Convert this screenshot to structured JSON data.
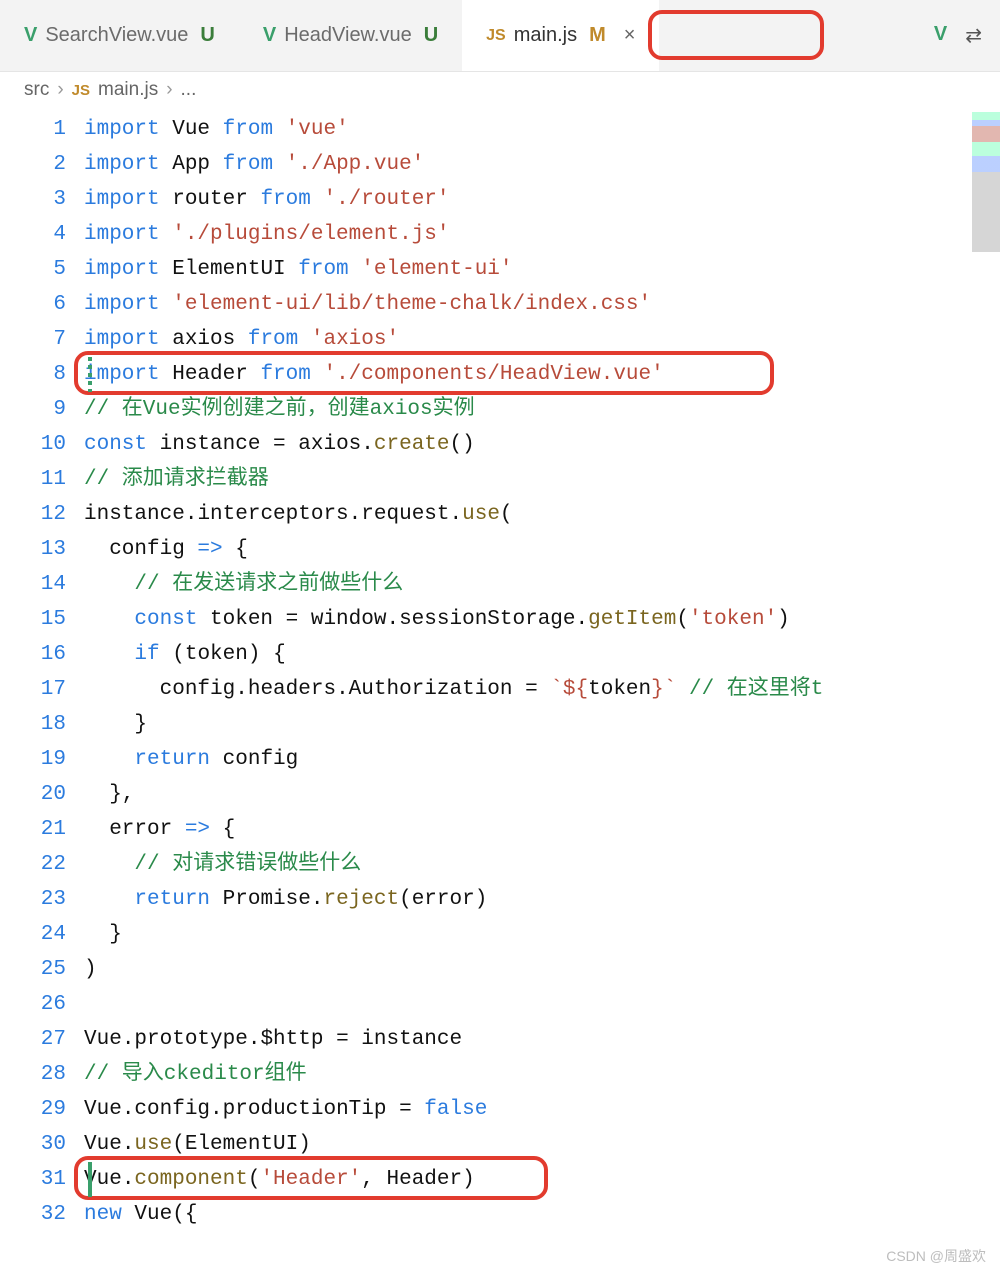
{
  "tabs": [
    {
      "icon": "vue",
      "label": "SearchView.vue",
      "status": "U"
    },
    {
      "icon": "vue",
      "label": "HeadView.vue",
      "status": "U"
    },
    {
      "icon": "js",
      "label": "main.js",
      "status": "M",
      "active": true,
      "closable": true
    },
    {
      "icon": "vue",
      "label": "",
      "status": ""
    }
  ],
  "breadcrumb": {
    "p1": "src",
    "sep": "›",
    "icon": "JS",
    "p2": "main.js",
    "p3": "..."
  },
  "code": {
    "lines": [
      {
        "n": 1,
        "t": [
          [
            "kw",
            "import"
          ],
          [
            "id",
            " Vue "
          ],
          [
            "kw",
            "from"
          ],
          [
            "str",
            " 'vue'"
          ]
        ]
      },
      {
        "n": 2,
        "t": [
          [
            "kw",
            "import"
          ],
          [
            "id",
            " App "
          ],
          [
            "kw",
            "from"
          ],
          [
            "str",
            " './App.vue'"
          ]
        ]
      },
      {
        "n": 3,
        "t": [
          [
            "kw",
            "import"
          ],
          [
            "id",
            " router "
          ],
          [
            "kw",
            "from"
          ],
          [
            "str",
            " './router'"
          ]
        ]
      },
      {
        "n": 4,
        "t": [
          [
            "kw",
            "import"
          ],
          [
            "str",
            " './plugins/element.js'"
          ]
        ]
      },
      {
        "n": 5,
        "t": [
          [
            "kw",
            "import"
          ],
          [
            "id",
            " ElementUI "
          ],
          [
            "kw",
            "from"
          ],
          [
            "str",
            " 'element-ui'"
          ]
        ]
      },
      {
        "n": 6,
        "t": [
          [
            "kw",
            "import"
          ],
          [
            "str",
            " 'element-ui/lib/theme-chalk/index.css'"
          ]
        ]
      },
      {
        "n": 7,
        "t": [
          [
            "kw",
            "import"
          ],
          [
            "id",
            " axios "
          ],
          [
            "kw",
            "from"
          ],
          [
            "str",
            " 'axios'"
          ]
        ]
      },
      {
        "n": 8,
        "t": [
          [
            "kw",
            "import"
          ],
          [
            "id",
            " Header "
          ],
          [
            "kw",
            "from"
          ],
          [
            "str",
            " './components/HeadView.vue'"
          ]
        ],
        "hl": "line8"
      },
      {
        "n": 9,
        "t": [
          [
            "cmt",
            "// 在Vue实例创建之前，创建axios实例"
          ]
        ]
      },
      {
        "n": 10,
        "t": [
          [
            "kw",
            "const"
          ],
          [
            "id",
            " instance "
          ],
          [
            "pun",
            "="
          ],
          [
            "id",
            " axios"
          ],
          [
            "pun",
            "."
          ],
          [
            "func",
            "create"
          ],
          [
            "pun",
            "()"
          ]
        ]
      },
      {
        "n": 11,
        "t": [
          [
            "cmt",
            "// 添加请求拦截器"
          ]
        ]
      },
      {
        "n": 12,
        "t": [
          [
            "id",
            "instance"
          ],
          [
            "pun",
            "."
          ],
          [
            "id",
            "interceptors"
          ],
          [
            "pun",
            "."
          ],
          [
            "id",
            "request"
          ],
          [
            "pun",
            "."
          ],
          [
            "func",
            "use"
          ],
          [
            "pun",
            "("
          ]
        ]
      },
      {
        "n": 13,
        "t": [
          [
            "id",
            "  config "
          ],
          [
            "arrow",
            "=>"
          ],
          [
            "pun",
            " {"
          ]
        ]
      },
      {
        "n": 14,
        "t": [
          [
            "cmt",
            "    // 在发送请求之前做些什么"
          ]
        ]
      },
      {
        "n": 15,
        "t": [
          [
            "kw",
            "    const"
          ],
          [
            "id",
            " token "
          ],
          [
            "pun",
            "="
          ],
          [
            "id",
            " window"
          ],
          [
            "pun",
            "."
          ],
          [
            "id",
            "sessionStorage"
          ],
          [
            "pun",
            "."
          ],
          [
            "func",
            "getItem"
          ],
          [
            "pun",
            "("
          ],
          [
            "str",
            "'token'"
          ],
          [
            "pun",
            ")"
          ]
        ]
      },
      {
        "n": 16,
        "t": [
          [
            "kw",
            "    if"
          ],
          [
            "pun",
            " ("
          ],
          [
            "id",
            "token"
          ],
          [
            "pun",
            ") {"
          ]
        ]
      },
      {
        "n": 17,
        "t": [
          [
            "id",
            "      config"
          ],
          [
            "pun",
            "."
          ],
          [
            "id",
            "headers"
          ],
          [
            "pun",
            "."
          ],
          [
            "id",
            "Authorization"
          ],
          [
            "pun",
            " = "
          ],
          [
            "str",
            "`${"
          ],
          [
            "id",
            "token"
          ],
          [
            "str",
            "}`"
          ],
          [
            "cmt",
            " // 在这里将t"
          ]
        ]
      },
      {
        "n": 18,
        "t": [
          [
            "pun",
            "    }"
          ]
        ]
      },
      {
        "n": 19,
        "t": [
          [
            "kw",
            "    return"
          ],
          [
            "id",
            " config"
          ]
        ]
      },
      {
        "n": 20,
        "t": [
          [
            "pun",
            "  },"
          ]
        ]
      },
      {
        "n": 21,
        "t": [
          [
            "id",
            "  error "
          ],
          [
            "arrow",
            "=>"
          ],
          [
            "pun",
            " {"
          ]
        ]
      },
      {
        "n": 22,
        "t": [
          [
            "cmt",
            "    // 对请求错误做些什么"
          ]
        ]
      },
      {
        "n": 23,
        "t": [
          [
            "kw",
            "    return"
          ],
          [
            "id",
            " Promise"
          ],
          [
            "pun",
            "."
          ],
          [
            "func",
            "reject"
          ],
          [
            "pun",
            "("
          ],
          [
            "id",
            "error"
          ],
          [
            "pun",
            ")"
          ]
        ]
      },
      {
        "n": 24,
        "t": [
          [
            "pun",
            "  }"
          ]
        ]
      },
      {
        "n": 25,
        "t": [
          [
            "pun",
            ")"
          ]
        ]
      },
      {
        "n": 26,
        "t": [
          [
            "id",
            ""
          ]
        ]
      },
      {
        "n": 27,
        "t": [
          [
            "id",
            "Vue"
          ],
          [
            "pun",
            "."
          ],
          [
            "id",
            "prototype"
          ],
          [
            "pun",
            "."
          ],
          [
            "id",
            "$http"
          ],
          [
            "pun",
            " = "
          ],
          [
            "id",
            "instance"
          ]
        ]
      },
      {
        "n": 28,
        "t": [
          [
            "cmt",
            "// 导入ckeditor组件"
          ]
        ]
      },
      {
        "n": 29,
        "t": [
          [
            "id",
            "Vue"
          ],
          [
            "pun",
            "."
          ],
          [
            "id",
            "config"
          ],
          [
            "pun",
            "."
          ],
          [
            "id",
            "productionTip"
          ],
          [
            "pun",
            " = "
          ],
          [
            "bool",
            "false"
          ]
        ]
      },
      {
        "n": 30,
        "t": [
          [
            "id",
            "Vue"
          ],
          [
            "pun",
            "."
          ],
          [
            "func",
            "use"
          ],
          [
            "pun",
            "("
          ],
          [
            "id",
            "ElementUI"
          ],
          [
            "pun",
            ")"
          ]
        ]
      },
      {
        "n": 31,
        "t": [
          [
            "id",
            "Vue"
          ],
          [
            "pun",
            "."
          ],
          [
            "func",
            "component"
          ],
          [
            "pun",
            "("
          ],
          [
            "str",
            "'Header'"
          ],
          [
            "pun",
            ", "
          ],
          [
            "id",
            "Header"
          ],
          [
            "pun",
            ")"
          ]
        ],
        "hl": "line31"
      },
      {
        "n": 32,
        "t": [
          [
            "kw",
            "new"
          ],
          [
            "id",
            " Vue"
          ],
          [
            "pun",
            "({"
          ]
        ]
      }
    ]
  },
  "watermark": "CSDN @周盛欢"
}
